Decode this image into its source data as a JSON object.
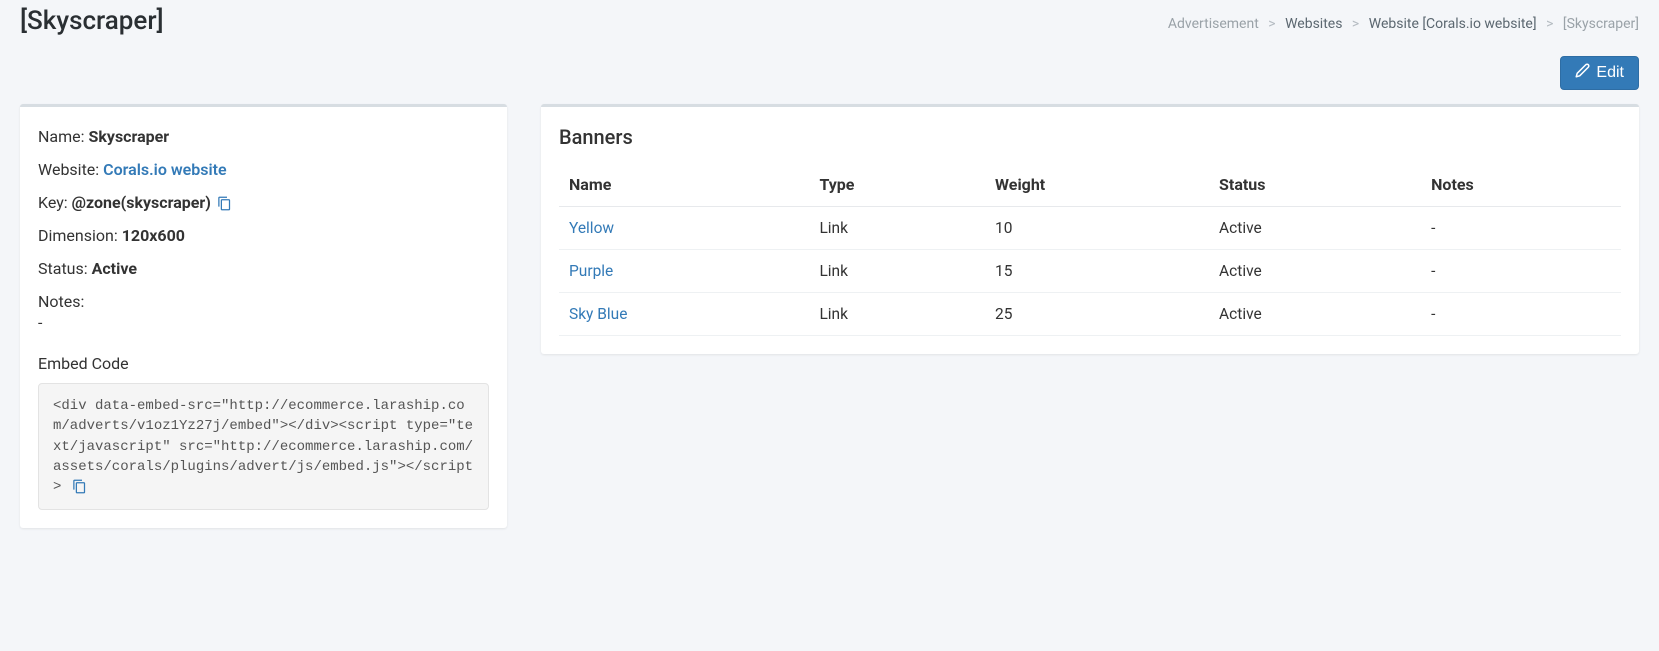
{
  "page_title": "[Skyscraper]",
  "breadcrumb": {
    "item1": "Advertisement",
    "item2": "Websites",
    "item3": "Website [Corals.io website]",
    "item4": "[Skyscraper]"
  },
  "actions": {
    "edit_label": "Edit"
  },
  "details": {
    "name_label": "Name:",
    "name_value": "Skyscraper",
    "website_label": "Website:",
    "website_value": "Corals.io website",
    "key_label": "Key:",
    "key_value": "@zone(skyscraper)",
    "dimension_label": "Dimension:",
    "dimension_value": "120x600",
    "status_label": "Status:",
    "status_value": "Active",
    "notes_label": "Notes:",
    "notes_value": "-",
    "embed_label": "Embed Code",
    "embed_code": "<div data-embed-src=\"http://ecommerce.laraship.com/adverts/v1oz1Yz27j/embed\"></div><script type=\"text/javascript\" src=\"http://ecommerce.laraship.com/assets/corals/plugins/advert/js/embed.js\"></script>"
  },
  "banners": {
    "title": "Banners",
    "columns": {
      "name": "Name",
      "type": "Type",
      "weight": "Weight",
      "status": "Status",
      "notes": "Notes"
    },
    "rows": [
      {
        "name": "Yellow",
        "type": "Link",
        "weight": "10",
        "status": "Active",
        "notes": "-"
      },
      {
        "name": "Purple",
        "type": "Link",
        "weight": "15",
        "status": "Active",
        "notes": "-"
      },
      {
        "name": "Sky Blue",
        "type": "Link",
        "weight": "25",
        "status": "Active",
        "notes": "-"
      }
    ]
  }
}
